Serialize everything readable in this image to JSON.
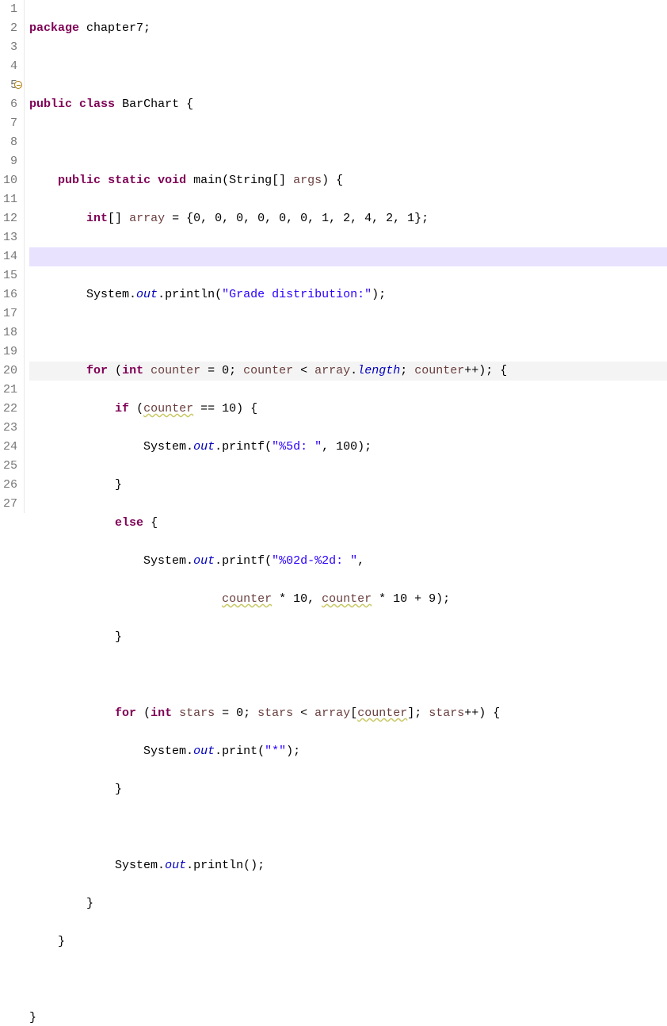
{
  "gutter": {
    "lines": [
      "1",
      "2",
      "3",
      "4",
      "5",
      "6",
      "7",
      "8",
      "9",
      "10",
      "11",
      "12",
      "13",
      "14",
      "15",
      "16",
      "17",
      "18",
      "19",
      "20",
      "21",
      "22",
      "23",
      "24",
      "25",
      "26",
      "27"
    ],
    "markerLine": 5
  },
  "code": {
    "l1": {
      "kw_package": "package",
      "pkg": " chapter7;"
    },
    "l3": {
      "kw_public": "public",
      "kw_class": "class",
      "name": " BarChart {"
    },
    "l5": {
      "kw_public": "public",
      "kw_static": "static",
      "kw_void": "void",
      "method": " main(String[] ",
      "param": "args",
      "rest": ") {"
    },
    "l6": {
      "kw_int": "int",
      "brackets": "[] ",
      "var": "array",
      "rest": " = {0, 0, 0, 0, 0, 0, 1, 2, 4, 2, 1};"
    },
    "l8": {
      "pre": "System.",
      "out": "out",
      "mid": ".println(",
      "str": "\"Grade distribution:\"",
      "post": ");"
    },
    "l10": {
      "kw_for": "for",
      "p1": " (",
      "kw_int": "int",
      "sp": " ",
      "counter": "counter",
      "eq": " = 0; ",
      "counter2": "counter",
      "lt": " < ",
      "array": "array",
      "dot": ".",
      "length": "length",
      "inc": "; ",
      "counter3": "counter",
      "pp": "++); {"
    },
    "l11": {
      "kw_if": "if",
      "p1": " (",
      "counter": "counter",
      "rest": " == 10) {"
    },
    "l12": {
      "pre": "System.",
      "out": "out",
      "mid": ".printf(",
      "str": "\"%5d: \"",
      "post": ", 100);"
    },
    "l13": {
      "brace": "}"
    },
    "l14": {
      "kw_else": "else",
      "rest": " {"
    },
    "l15": {
      "pre": "System.",
      "out": "out",
      "mid": ".printf(",
      "str": "\"%02d-%2d: \"",
      "post": ","
    },
    "l16": {
      "counter1": "counter",
      "mid": " * 10, ",
      "counter2": "counter",
      "rest": " * 10 + 9);"
    },
    "l17": {
      "brace": "}"
    },
    "l19": {
      "kw_for": "for",
      "p1": " (",
      "kw_int": "int",
      "sp": " ",
      "stars": "stars",
      "eq": " = 0; ",
      "stars2": "stars",
      "lt": " < ",
      "array": "array",
      "br": "[",
      "counter": "counter",
      "cb": "]; ",
      "stars3": "stars",
      "pp": "++) {"
    },
    "l20": {
      "pre": "System.",
      "out": "out",
      "mid": ".print(",
      "str": "\"*\"",
      "post": ");"
    },
    "l21": {
      "brace": "}"
    },
    "l23": {
      "pre": "System.",
      "out": "out",
      "mid": ".println();"
    },
    "l24": {
      "brace": "}"
    },
    "l25": {
      "brace": "}"
    },
    "l27": {
      "brace": "}"
    }
  }
}
